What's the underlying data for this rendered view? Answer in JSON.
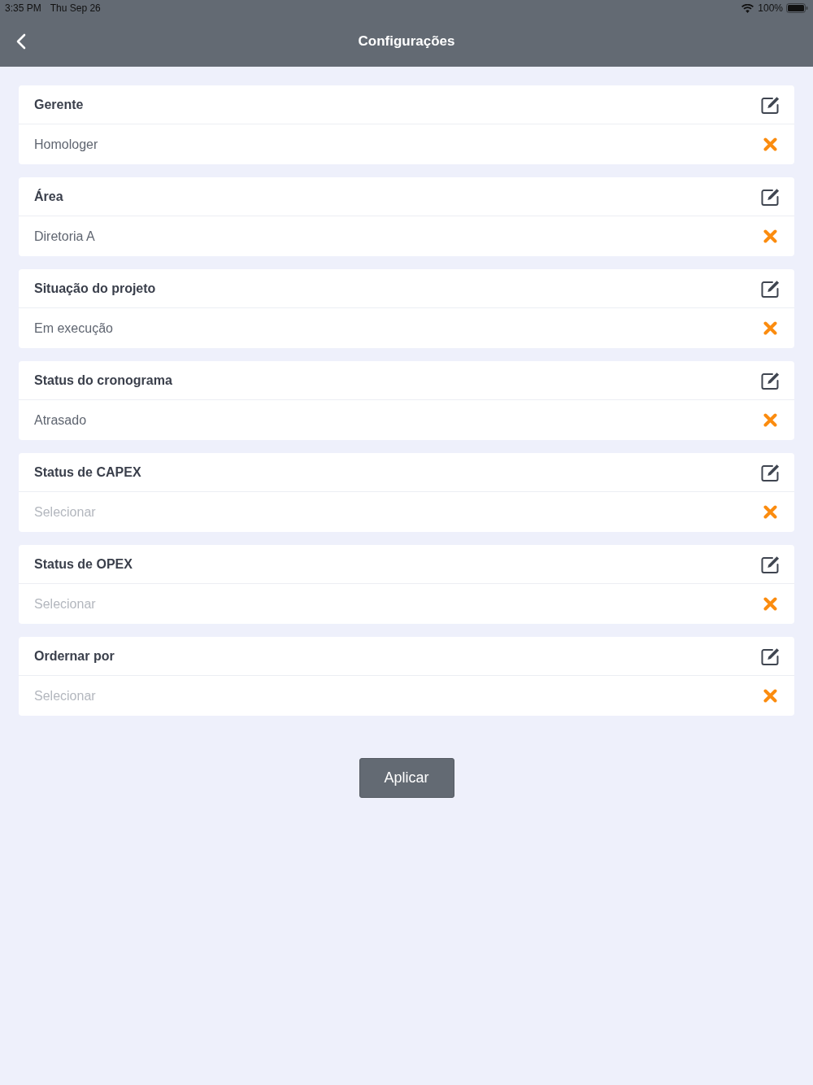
{
  "status_bar": {
    "time": "3:35 PM",
    "date": "Thu Sep 26",
    "battery": "100%"
  },
  "nav_bar": {
    "title": "Configurações"
  },
  "filters": [
    {
      "label": "Gerente",
      "value": "Homologer"
    },
    {
      "label": "Área",
      "value": "Diretoria A"
    },
    {
      "label": "Situação do projeto",
      "value": "Em execução"
    },
    {
      "label": "Status do cronograma",
      "value": "Atrasado"
    },
    {
      "label": "Status de CAPEX",
      "placeholder": "Selecionar"
    },
    {
      "label": "Status de OPEX",
      "placeholder": "Selecionar"
    },
    {
      "label": "Ordernar por",
      "placeholder": "Selecionar"
    }
  ],
  "apply_button": {
    "label": "Aplicar"
  }
}
